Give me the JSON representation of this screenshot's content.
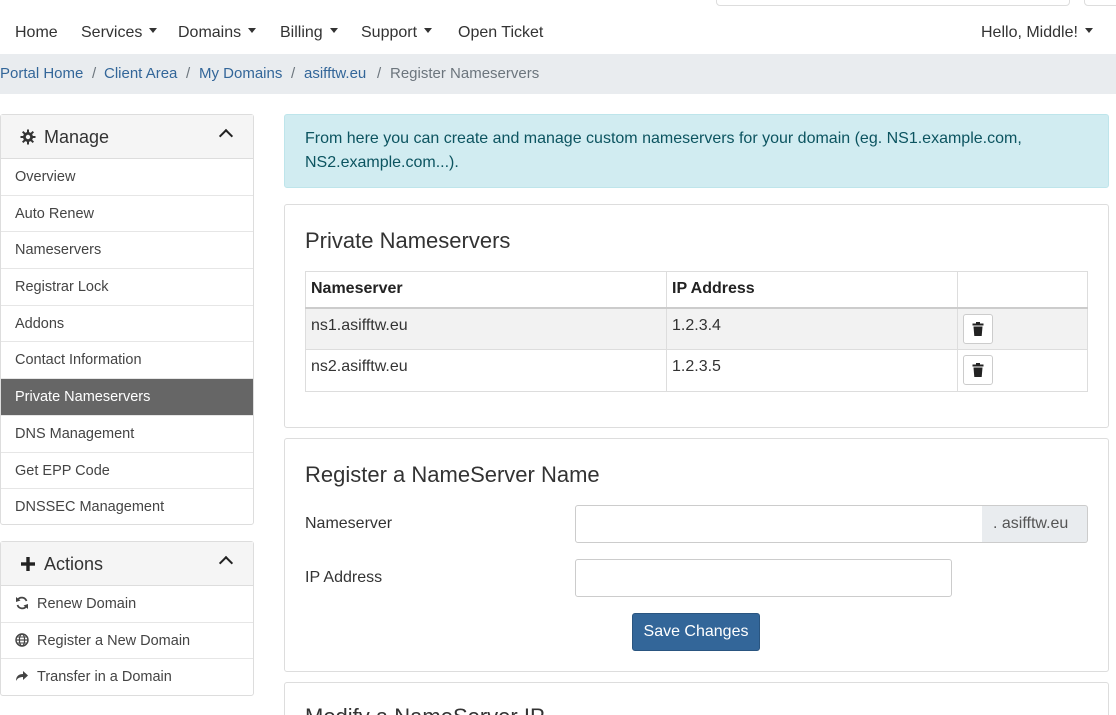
{
  "nav": {
    "items": [
      {
        "label": "Home",
        "dropdown": false
      },
      {
        "label": "Services",
        "dropdown": true
      },
      {
        "label": "Domains",
        "dropdown": true
      },
      {
        "label": "Billing",
        "dropdown": true
      },
      {
        "label": "Support",
        "dropdown": true
      },
      {
        "label": "Open Ticket",
        "dropdown": false
      }
    ],
    "user_greeting": "Hello, Middle!"
  },
  "breadcrumb": {
    "items": [
      "Portal Home",
      "Client Area",
      "My Domains",
      "asifftw.eu",
      "Register Nameservers"
    ],
    "separator": "/"
  },
  "sidebar": {
    "manage": {
      "title": "Manage",
      "icon": "gear-icon",
      "items": [
        "Overview",
        "Auto Renew",
        "Nameservers",
        "Registrar Lock",
        "Addons",
        "Contact Information",
        "Private Nameservers",
        "DNS Management",
        "Get EPP Code",
        "DNSSEC Management"
      ],
      "active_item": "Private Nameservers"
    },
    "actions": {
      "title": "Actions",
      "icon": "plus-icon",
      "items": [
        {
          "label": "Renew Domain",
          "icon": "refresh-icon"
        },
        {
          "label": "Register a New Domain",
          "icon": "globe-icon"
        },
        {
          "label": "Transfer in a Domain",
          "icon": "share-icon"
        }
      ]
    }
  },
  "info_alert": {
    "text": "From here you can create and manage custom nameservers for your domain (eg. NS1.example.com, NS2.example.com...)."
  },
  "private_nameservers": {
    "title": "Private Nameservers",
    "columns": [
      "Nameserver",
      "IP Address",
      ""
    ],
    "rows": [
      {
        "nameserver": "ns1.asifftw.eu",
        "ip": "1.2.3.4"
      },
      {
        "nameserver": "ns2.asifftw.eu",
        "ip": "1.2.3.5"
      }
    ]
  },
  "register_form": {
    "title": "Register a NameServer Name",
    "nameserver_label": "Nameserver",
    "nameserver_value": "",
    "nameserver_suffix": ". asifftw.eu",
    "ip_label": "IP Address",
    "ip_value": "",
    "save_label": "Save Changes"
  },
  "modify_section": {
    "title": "Modify a NameServer IP"
  },
  "colors": {
    "link": "#336699",
    "primary_button": "#336699",
    "active_sidebar": "#666666",
    "alert_bg": "#d1ecf1",
    "alert_text": "#0c5460"
  }
}
